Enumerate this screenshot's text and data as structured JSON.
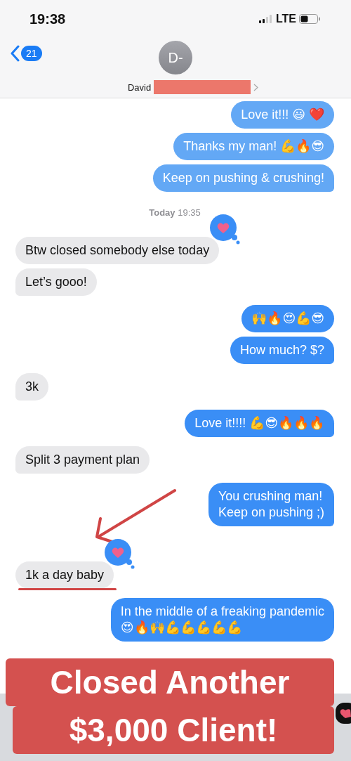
{
  "status_bar": {
    "time": "19:38",
    "network": "LTE"
  },
  "header": {
    "back_count": "21",
    "avatar_initials": "D-",
    "contact_name": "David"
  },
  "messages": [
    {
      "kind": "sent",
      "text": "Love it!!! 😃 ❤️",
      "tail": false,
      "reaction": false
    },
    {
      "kind": "sent",
      "text": "Thanks my man! 💪🔥😎",
      "tail": false,
      "reaction": false
    },
    {
      "kind": "sent",
      "text": "Keep on pushing & crushing!",
      "tail": true,
      "reaction": false
    },
    {
      "kind": "timestamp",
      "day": "Today",
      "time": "19:35"
    },
    {
      "kind": "received",
      "text": "Btw closed somebody else today",
      "tail": false,
      "reaction": true
    },
    {
      "kind": "received",
      "text": "Let’s gooo!",
      "tail": true,
      "reaction": false
    },
    {
      "kind": "sent",
      "text": "🙌🔥😍💪😎",
      "tail": false,
      "reaction": false
    },
    {
      "kind": "sent",
      "text": "How much? $?",
      "tail": true,
      "reaction": false
    },
    {
      "kind": "received",
      "text": "3k",
      "tail": true,
      "reaction": false
    },
    {
      "kind": "sent",
      "text": "Love it!!!! 💪😎🔥🔥🔥",
      "tail": true,
      "reaction": false
    },
    {
      "kind": "received",
      "text": "Split 3 payment plan",
      "tail": true,
      "reaction": false
    },
    {
      "kind": "sent",
      "text": "You crushing man!\nKeep on pushing ;)",
      "tail": true,
      "reaction": false
    },
    {
      "kind": "received",
      "text": "1k a day baby",
      "tail": false,
      "reaction": true,
      "annotated": true
    },
    {
      "kind": "sent",
      "text": "In the middle of a freaking pandemic\n😍🔥🙌💪💪💪💪💪",
      "tail": false,
      "reaction": false
    }
  ],
  "caption": [
    "Closed Another",
    "$3,000 Client!"
  ]
}
